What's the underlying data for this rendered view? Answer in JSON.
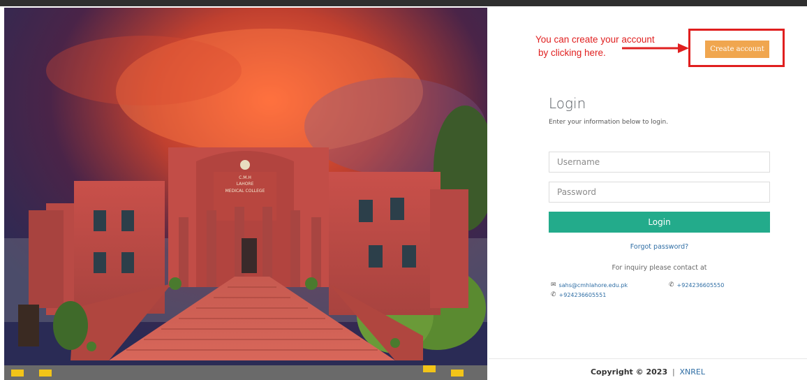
{
  "annotation": {
    "line1": "You can create your account",
    "line2": "by clicking here.",
    "color": "#e02020"
  },
  "header": {
    "create_account_label": "Create account",
    "create_account_color": "#f0a64f"
  },
  "login": {
    "title": "Login",
    "subtitle": "Enter your information below to login.",
    "username_placeholder": "Username",
    "password_placeholder": "Password",
    "submit_label": "Login",
    "submit_color": "#23ab8b",
    "forgot_label": "Forgot password?"
  },
  "contact": {
    "inquiry_text": "For inquiry please contact at",
    "email": "sahs@cmhlahore.edu.pk",
    "phone1": "+924236605550",
    "phone2": "+924236605551",
    "email_icon": "envelope-icon",
    "phone_icon": "phone-icon"
  },
  "footer": {
    "copyright": "Copyright © 2023",
    "separator": "|",
    "brand": "XNREL"
  },
  "photo": {
    "building_sign_1": "C.M.H",
    "building_sign_2": "LAHORE",
    "building_sign_3": "MEDICAL COLLEGE"
  }
}
